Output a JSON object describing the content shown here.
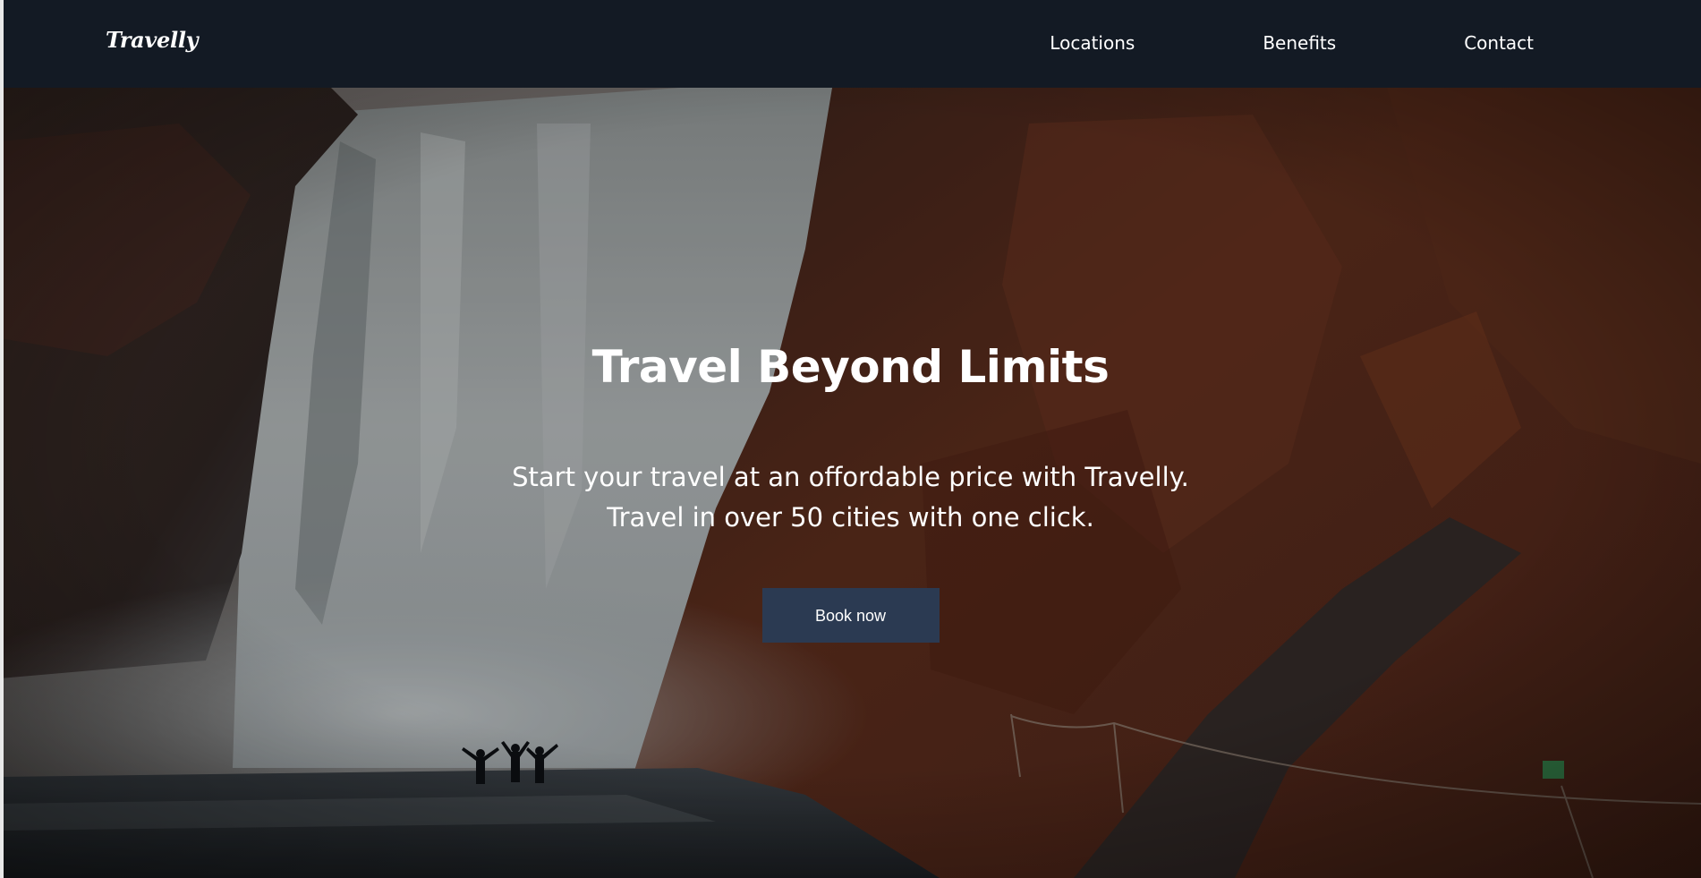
{
  "brand": {
    "logo_text": "Travelly"
  },
  "nav": {
    "items": [
      {
        "label": "Locations"
      },
      {
        "label": "Benefits"
      },
      {
        "label": "Contact"
      }
    ]
  },
  "hero": {
    "title": "Travel Beyond Limits",
    "subtitle_line1": "Start your travel at an offordable price with Travelly.",
    "subtitle_line2": "Travel in over 50 cities with one click.",
    "cta_label": "Book now"
  },
  "colors": {
    "navbar_bg": "#131a24",
    "button_bg": "#2b3a52",
    "text": "#ffffff"
  }
}
